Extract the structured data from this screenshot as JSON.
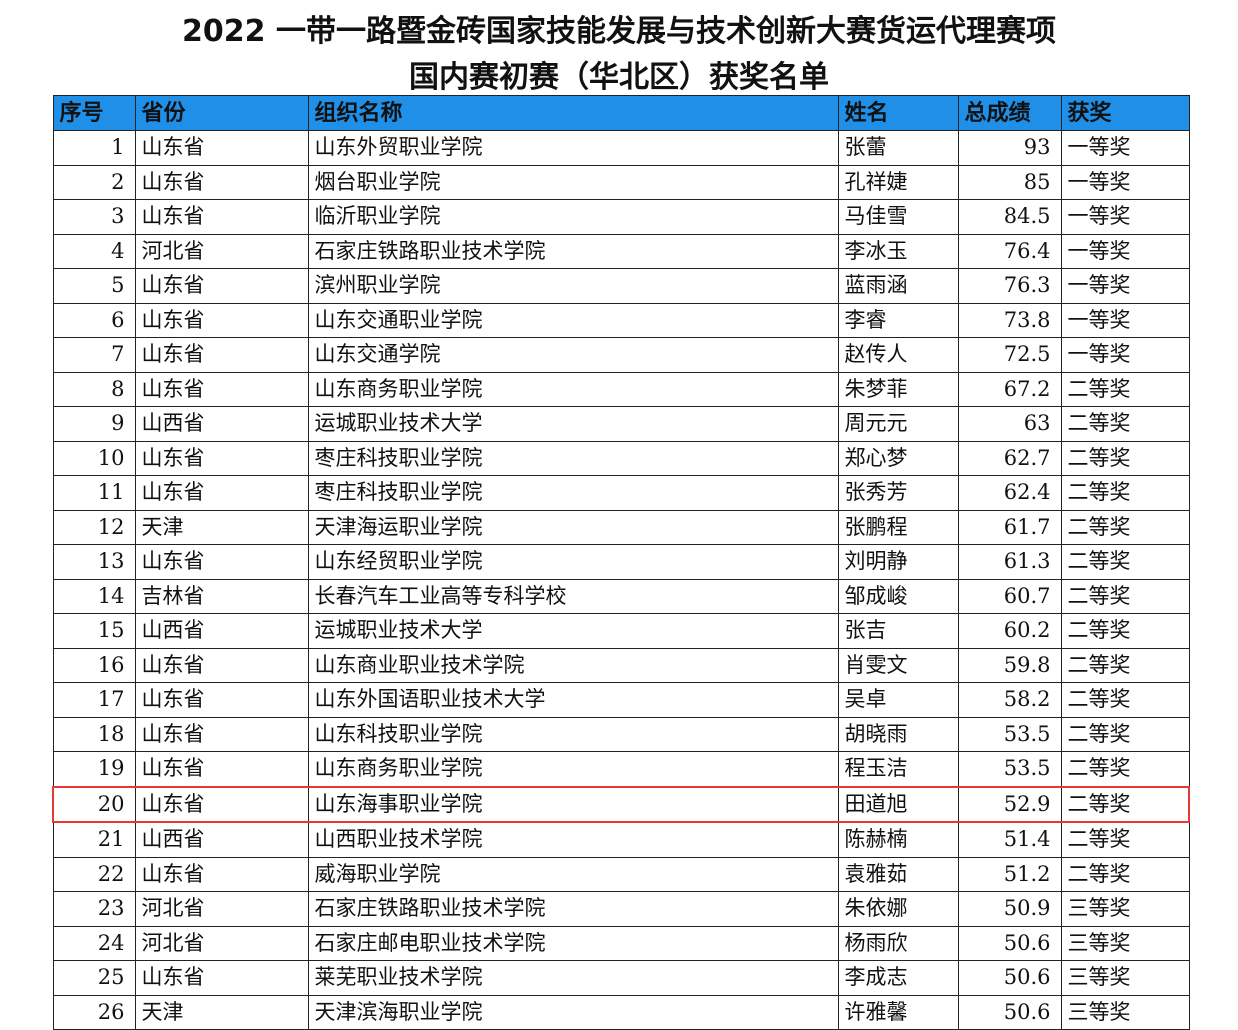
{
  "title_line1": "2022 一带一路暨金砖国家技能发展与技术创新大赛货运代理赛项",
  "title_line2": "国内赛初赛（华北区）获奖名单",
  "headers": [
    "序号",
    "省份",
    "组织名称",
    "姓名",
    "总成绩",
    "获奖"
  ],
  "highlight_color": "#e53935",
  "header_color": "#1F8FE8",
  "highlighted_row": "20",
  "rows": [
    [
      "1",
      "山东省",
      "山东外贸职业学院",
      "张蕾",
      "93",
      "一等奖"
    ],
    [
      "2",
      "山东省",
      "烟台职业学院",
      "孔祥婕",
      "85",
      "一等奖"
    ],
    [
      "3",
      "山东省",
      "临沂职业学院",
      "马佳雪",
      "84.5",
      "一等奖"
    ],
    [
      "4",
      "河北省",
      "石家庄铁路职业技术学院",
      "李冰玉",
      "76.4",
      "一等奖"
    ],
    [
      "5",
      "山东省",
      "滨州职业学院",
      "蓝雨涵",
      "76.3",
      "一等奖"
    ],
    [
      "6",
      "山东省",
      "山东交通职业学院",
      "李睿",
      "73.8",
      "一等奖"
    ],
    [
      "7",
      "山东省",
      "山东交通学院",
      "赵传人",
      "72.5",
      "一等奖"
    ],
    [
      "8",
      "山东省",
      "山东商务职业学院",
      "朱梦菲",
      "67.2",
      "二等奖"
    ],
    [
      "9",
      "山西省",
      "运城职业技术大学",
      "周元元",
      "63",
      "二等奖"
    ],
    [
      "10",
      "山东省",
      "枣庄科技职业学院",
      "郑心梦",
      "62.7",
      "二等奖"
    ],
    [
      "11",
      "山东省",
      "枣庄科技职业学院",
      "张秀芳",
      "62.4",
      "二等奖"
    ],
    [
      "12",
      "天津",
      "天津海运职业学院",
      "张鹏程",
      "61.7",
      "二等奖"
    ],
    [
      "13",
      "山东省",
      "山东经贸职业学院",
      "刘明静",
      "61.3",
      "二等奖"
    ],
    [
      "14",
      "吉林省",
      "长春汽车工业高等专科学校",
      "邹成峻",
      "60.7",
      "二等奖"
    ],
    [
      "15",
      "山西省",
      "运城职业技术大学",
      "张吉",
      "60.2",
      "二等奖"
    ],
    [
      "16",
      "山东省",
      "山东商业职业技术学院",
      "肖雯文",
      "59.8",
      "二等奖"
    ],
    [
      "17",
      "山东省",
      "山东外国语职业技术大学",
      "吴卓",
      "58.2",
      "二等奖"
    ],
    [
      "18",
      "山东省",
      "山东科技职业学院",
      "胡晓雨",
      "53.5",
      "二等奖"
    ],
    [
      "19",
      "山东省",
      "山东商务职业学院",
      "程玉洁",
      "53.5",
      "二等奖"
    ],
    [
      "20",
      "山东省",
      "山东海事职业学院",
      "田道旭",
      "52.9",
      "二等奖"
    ],
    [
      "21",
      "山西省",
      "山西职业技术学院",
      "陈赫楠",
      "51.4",
      "二等奖"
    ],
    [
      "22",
      "山东省",
      "威海职业学院",
      "袁雅茹",
      "51.2",
      "二等奖"
    ],
    [
      "23",
      "河北省",
      "石家庄铁路职业技术学院",
      "朱依娜",
      "50.9",
      "三等奖"
    ],
    [
      "24",
      "河北省",
      "石家庄邮电职业技术学院",
      "杨雨欣",
      "50.6",
      "三等奖"
    ],
    [
      "25",
      "山东省",
      "莱芜职业技术学院",
      "李成志",
      "50.6",
      "三等奖"
    ],
    [
      "26",
      "天津",
      "天津滨海职业学院",
      "许雅馨",
      "50.6",
      "三等奖"
    ]
  ]
}
